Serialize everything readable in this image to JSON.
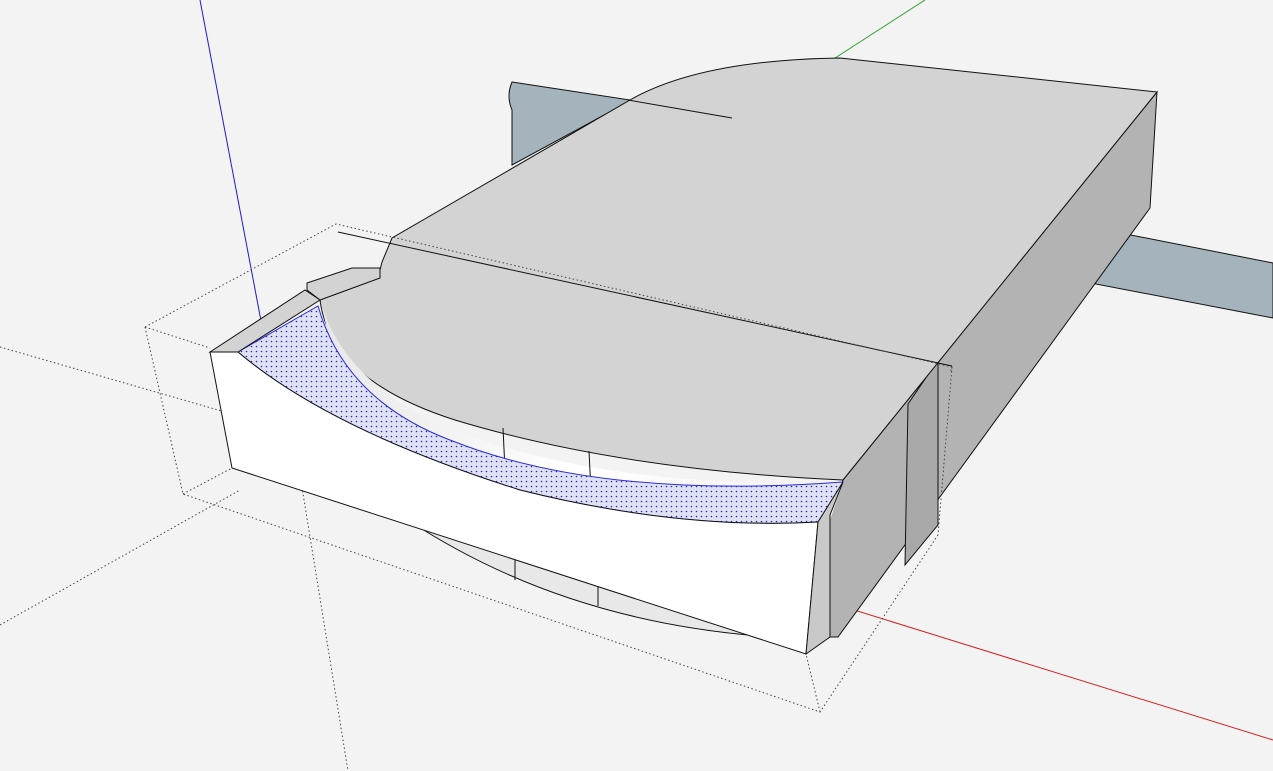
{
  "app": {
    "view": "3d-model-viewport"
  },
  "colors": {
    "background": "#f3f3f3",
    "axis_red": "#d21e1e",
    "axis_green": "#2ca02c",
    "axis_blue": "#1b1bd6",
    "face_top": "#d3d3d3",
    "face_side_dark": "#b5b5b5",
    "face_front": "#ffffff",
    "selection_hatch": "#3b3be0",
    "protrusion_blue_gray": "#a5b3bc"
  },
  "scene": {
    "icons": [
      "red-axis-icon",
      "green-axis-icon",
      "blue-axis-icon"
    ],
    "objects": [
      "main-block",
      "rounded-top-face",
      "curved-cut-face",
      "left-protrusion",
      "right-protrusion",
      "bounding-box"
    ]
  }
}
